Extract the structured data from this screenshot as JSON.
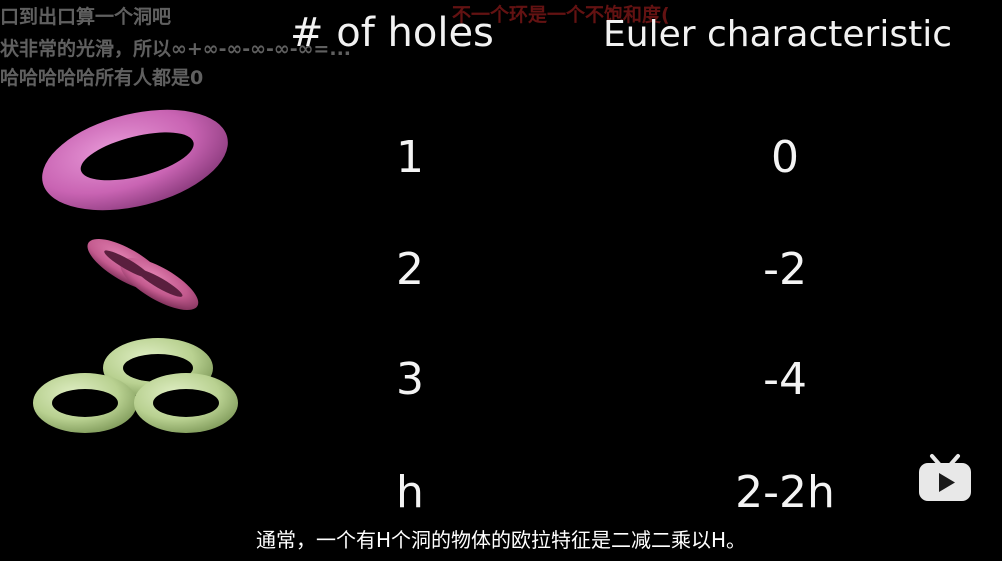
{
  "danmaku": [
    "口到出口算一个洞吧",
    "状非常的光滑，所以∞+∞-∞-∞-∞-∞=...",
    "哈哈哈哈哈所有人都是0"
  ],
  "danmaku_red": "不一个环是一个不饱和度(",
  "table": {
    "header_holes": "# of holes",
    "header_euler": "Euler characteristic",
    "rows": [
      {
        "holes": "1",
        "euler": "0",
        "shape": "single-torus"
      },
      {
        "holes": "2",
        "euler": "-2",
        "shape": "double-torus"
      },
      {
        "holes": "3",
        "euler": "-4",
        "shape": "triple-torus"
      },
      {
        "holes": "h",
        "euler": "2-2h",
        "shape": ""
      }
    ]
  },
  "subtitle": "通常，一个有H个洞的物体的欧拉特征是二减二乘以H。",
  "colors": {
    "background": "#000000",
    "torus1": "#d26fc0",
    "torus2": "#c85c92",
    "torus3": "#c3d8a0"
  },
  "icons": {
    "player_logo": "bilibili-tv-icon"
  }
}
